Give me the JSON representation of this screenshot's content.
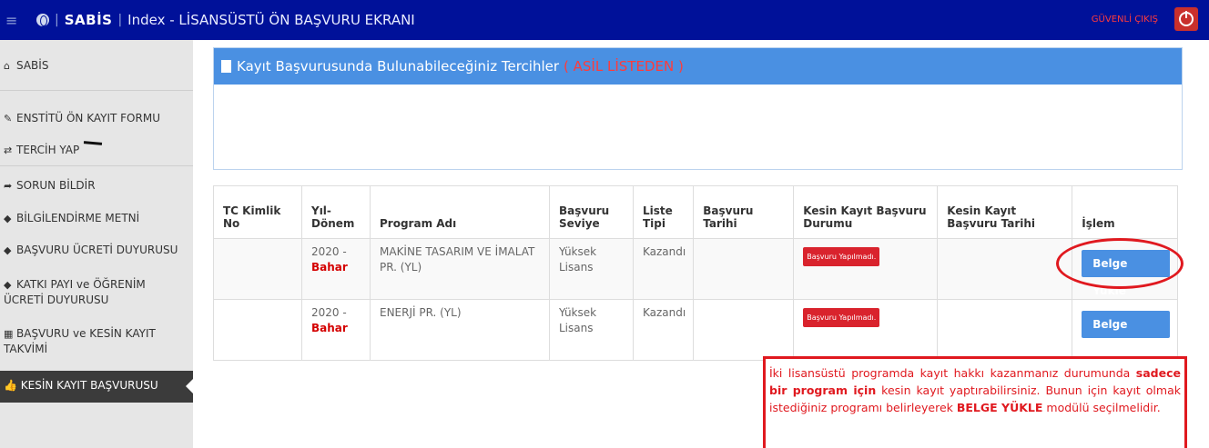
{
  "topbar": {
    "brand": "SABİS",
    "title": "Index - LİSANSÜSTÜ ÖN BAŞVURU EKRANI",
    "logout": "GÜVENLİ ÇIKIŞ"
  },
  "sidebar": {
    "items": [
      {
        "label": "SABİS",
        "icon": "home-icon"
      },
      {
        "label": "ENSTİTÜ ÖN KAYIT FORMU",
        "icon": "pencil-icon"
      },
      {
        "label": "TERCİH YAP",
        "icon": "exchange-icon"
      },
      {
        "label": "SORUN BİLDİR",
        "icon": "share-icon"
      },
      {
        "label": "BİLGİLENDİRME METNİ",
        "icon": "tag-icon"
      },
      {
        "label": "BAŞVURU ÜCRETİ DUYURUSU",
        "icon": "tag-icon"
      },
      {
        "label": "KATKI PAYI ve ÖĞRENİM ÜCRETİ DUYURUSU",
        "icon": "tag-icon"
      },
      {
        "label": "BAŞVURU ve KESİN KAYIT TAKVİMİ",
        "icon": "calendar-icon"
      },
      {
        "label": "KESİN KAYIT BAŞVURUSU",
        "icon": "thumbs-up-icon"
      }
    ]
  },
  "panel": {
    "title": "Kayıt Başvurusunda Bulunabileceğiniz Tercihler",
    "title_red": "( ASİL LİSTEDEN )"
  },
  "table": {
    "headers": [
      "TC Kimlik No",
      "Yıl-Dönem",
      "Program Adı",
      "Başvuru Seviye",
      "Liste Tipi",
      "Başvuru Tarihi",
      "Kesin Kayıt Başvuru Durumu",
      "Kesin Kayıt Başvuru Tarihi",
      "İşlem"
    ],
    "rows": [
      {
        "tc": "",
        "year": "2020 -",
        "term": "Bahar",
        "program": "MAKİNE TASARIM VE İMALAT PR. (YL)",
        "level": "Yüksek Lisans",
        "list_type": "Kazandı",
        "app_date": "",
        "status": "Başvuru Yapılmadı.",
        "final_date": "",
        "action": "Belge Yükle"
      },
      {
        "tc": "",
        "year": "2020 -",
        "term": "Bahar",
        "program": "ENERJİ PR. (YL)",
        "level": "Yüksek Lisans",
        "list_type": "Kazandı",
        "app_date": "",
        "status": "Başvuru Yapılmadı.",
        "final_date": "",
        "action": "Belge Yükle"
      }
    ]
  },
  "note": {
    "part1": "İki lisansüstü programda kayıt hakkı kazanmanız durumunda ",
    "bold1": "sadece bir program için",
    "part2": " kesin kayıt yaptırabilirsiniz. Bunun için kayıt olmak istediğiniz programı belirleyerek ",
    "bold2": "BELGE YÜKLE",
    "part3": " modülü seçilmelidir."
  },
  "colors": {
    "topbar": "#001199",
    "panel_header": "#4a90e2",
    "accent_red": "#e0191f",
    "sidebar_bg": "#e6e6e6",
    "sidebar_active": "#3b3b3b"
  }
}
